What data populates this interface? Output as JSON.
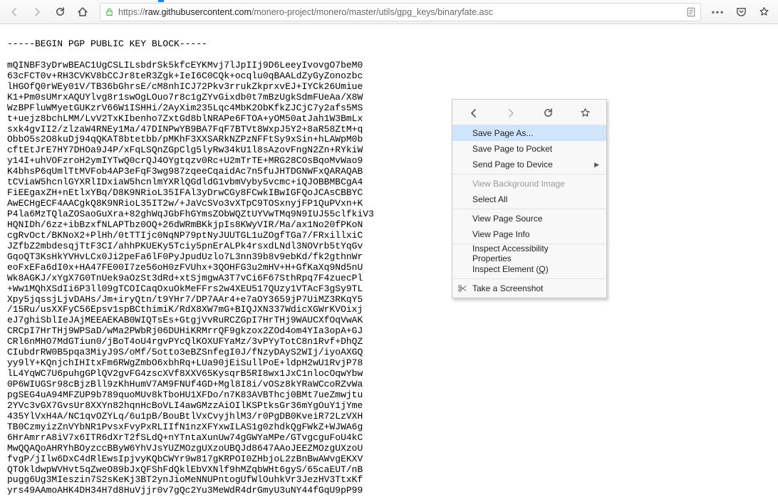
{
  "toolbar": {
    "url_scheme": "https://",
    "url_host": "raw.githubusercontent.com",
    "url_path": "/monero-project/monero/master/utils/gpg_keys/binaryfate.asc"
  },
  "ctx": {
    "save_as": "Save Page As...",
    "save_pocket": "Save Page to Pocket",
    "send_device": "Send Page to Device",
    "view_bg": "View Background Image",
    "select_all": "Select All",
    "view_source": "View Page Source",
    "view_info": "View Page Info",
    "inspect_acc": "Inspect Accessibility Properties",
    "inspect_el_pre": "Inspect Element (",
    "inspect_el_key": "Q",
    "inspect_el_post": ")",
    "screenshot": "Take a Screenshot"
  },
  "pgp": {
    "begin": "-----BEGIN PGP PUBLIC KEY BLOCK-----",
    "lines": [
      "mQINBF3yDrwBEAC1UgCSLILsbdrSk5kfcEYKMvj7lJpIIj9D6LeeyIvovgO7beM0",
      "63cFCT0v+RH3CVKV8bCCJr8teR3Zgk+IeI6C0CQk+ocqlu0qBAALdZyGyZonozbc",
      "lHGOfQ0rWEy01V/TB36bGhrsE/cM8nhICJ72Pkv3rrukZkprxvEJ+IYCk26Umiue",
      "K1+Pm0sUMrxAQUYlvg8r1swOgLOuo7r8c1gZYvGixdb0t7mBzUgkSdmFUeAa/X8W",
      "WzBPFluWMyetGUKzrV66W1ISHHi/2AyXim235Lqc4MbK2ObKfkZJCjC7y2afs5MS",
      "t+uejz8bchLMM/LvV2TxKIbenho7ZxtGd8blNRAPe6FTOA+yOM50atJah1W3BmLx",
      "sxk4gvII2/zlzaW4RNEy1Ma/47DINPwYB9BA7FqF7BTVt8WxpJ5Y2+8aR58ZtM+q",
      "ObbO5s2O8kuDj94qQKAT8btetbb/pMKhF3XXSARkNZPzNFFtSy9xSin+hLAWpM0b",
      "cftEtJrE7HY7DHOa9J4P/xFqLSQnZGpClg5lyRw34kU1l8sAzovFngN2Zn+RYkiW",
      "y14I+uhVOFzroH2ymIYTwQ0crQJ4OYgtqzv0Rc+U2mTrTE+MRG28COsBqoMvWao9",
      "K4bhsP6qUmlTtMVFob4AP3eFqF3wg987zqeeCqaidAc7n5fuJHTDGNWFxQARAQAB",
      "tCViaW5hcnlGYXRlIDxiaW5hcnlmYXRlQGdldG1vbmVyby5vcmc+iQJOBBMBCgA4",
      "FiEEgaxZH+nEtlxYBq/D8K9NRioL35IFAl3yDrwCGy8FCwkIBwIGFQoJCAsCBBYC",
      "AwECHgECF4AACgkQ8K9NRioL35IT2w/+JaVcSVo3vXTpC9TOSxnyjFP1QuPVxn+K",
      "P4la6MzTQlaZOSaoGuXra+82ghWqJGbFhGYmsZObWQZtUYVwTMq9N9IUJ55clfkiV3",
      "HQNIDh/6zz+ibBzxfNLAPTbz0OQ+26dWRmBKkjpIs8KWyVIR/Ma/ax1No20fPKoN",
      "cgRvOct/BKNoX2+PlHh/0tTTIjc0NqNP79ptNyJUUTGL1uZOgfTGa7/FRxillxiC",
      "JZfbZ2mbdesqjTtF3CI/ahhPKUEKy5Tciy5pnErALPk4rsxdLNdl3NOVrb5tYqGv",
      "GqoQT3KsHkYVHvLCx0Ji2peFa6lF0PyJpudUzlo7L3nn39b8v9ebKd/fk2gthnWr",
      "eoFxEFa6dI0x+HA47FE00I7ze56oH0zFVUhx+3QOHFG3u2mHV+H+GfKaXq9Nd5nU",
      "Wk8AGKJ/xYgX7G0TnUek9aOzSt3dRd+xtSjmgwA3T7vCi6F67SthRpq7F4zuecPl",
      "+Ww1MQhXSdIi6P3ll09gTCOICaqOxuOkMeFFrs2w4XEU517QUzy1VTAcF3gSy9TL",
      "Xpy5jqssjLjvDAHs/Jm+iryQtn/t9YHr7/DP7AAr4+e7aOY3659jP7UiMZ3RKqY5",
      "/15Ru/usXXFyC56Epsv1spBCthimiK/RdX8XW7mG+BIQJXN337WdicXGWrKVOixj",
      "eJ7ghiSblIeJAjMEEAEKAB0WIQTsEs+GtgjVvRuRCZGpI7HrTHj9WAUCXfOqVwAK",
      "CRCpI7HrTHj9WPSaD/wMa2PWbRj06DUHiKRMrrQF9gkzox2ZOd4om4YIa3opA+GJ",
      "CRl6nMHO7MdGTiun0/jBoT4oU4rgvPYcQlKOXUFYaMz/3vPYyTotC8n1Rvf+DhQZ",
      "CIubdrRW0B5pqa3MiyJ9S/oMf/5otto3eBZSnfegI0J/fNzyDAyS2WIj/iyoAXGQ",
      "yy9lY+KQnjchIHItxFm6RWgZmbO6xbhRq+LUa90jEiSullPoE+ldpH2wU1RvjP78",
      "lL4YqWC7U6puhgGPlQV2gvFG4zscXVf8XXV65KysqrB5RI8wx1JxC1nlocOqwYbw",
      "0P6WIUGSr98cBjzBll9zKhHumV7AM9FNUf4GD+Mgl8I8i/vOSz8kYRaWCcoRZvWa",
      "pgSEG4uA94MFZUP9b789quoMUv8kTboHU1XFDo/n7K83AVBThcj0BMt7ueZmwjtu",
      "2YVc3vGX7GvsUr8XXYn82hqnHcBoVLI4awGMzzAiOIlKSPtksGr36mYgOuY1jYme",
      "435YlVxH4A/NC1qvOZYLq/6u1pB/BouBtlVxCvyjhlM3/r0PgDB0KveiR72LzVXH",
      "TB0CzmyizZnVYbNR1PvsxFvyPxRLIIfN1nzXFYxwILAS1g0zhdkQgFWkZ+WJWA6g",
      "6HrAmrrA8iV7x6ITR6dXrT2fSLdQ+nYTntaXunUw74gGWYaMPe/GTvgcguFoU4kC",
      "MwQQAQoAHRYhBOyzccBByW6YhVJsYUZMOzgUXzoUBQJd8647AAoJEEZMOzgUXzoU",
      "fvgP/jIlw6DxC4dRlEwsIpjvyKQbCWYr9w817gKRPOI0ZHbjoL2zBnBwAWvgEKXV",
      "QTOkldwpWVHvt5qZweO89bJxQFShFdQklEbVXNlf9hMZqbWHt6gyS/65caEUT/nB",
      "pugg6Ug3MIeszin7S2sKeKj3BT2ynJioMeNNUPntogUfWlOuhkVr3JezHV3TtxKf",
      "yrs49AAmoAHK4DH34H7d8HuVjjr0v7gQc2Yu3MeWdR4drGmyU3uNY44fGqU9pP99"
    ]
  }
}
